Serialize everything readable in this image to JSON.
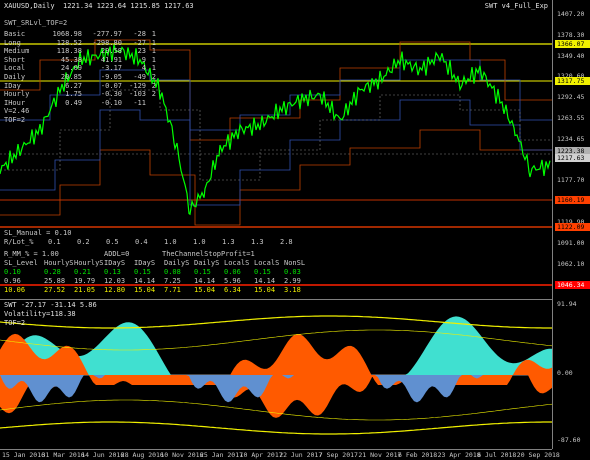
{
  "header": {
    "symbol_line": "XAUUSD,Daily  1221.34 1223.64 1215.85 1217.63",
    "indicator_name": "SWT_SRLvl_TOF=2",
    "right_label": "SWT v4_Full_Exp"
  },
  "srlvl_table": {
    "rows": [
      {
        "name": "Basic",
        "v1": "1068.98",
        "v2": "-277.97",
        "v3": "-28",
        "v4": "1"
      },
      {
        "name": "Long",
        "v1": "128.52",
        "v2": "-298.80",
        "v3": "-27",
        "v4": "1"
      },
      {
        "name": "Medium",
        "v1": "118.38",
        "v2": "29.58",
        "v3": "23",
        "v4": "1"
      },
      {
        "name": "Short",
        "v1": "45.38",
        "v2": "41.91",
        "v3": "9",
        "v4": "1"
      },
      {
        "name": "Local",
        "v1": "24.09",
        "v2": "-3.17",
        "v3": "4",
        "v4": "1"
      },
      {
        "name": "Daily",
        "v1": "20.85",
        "v2": "-9.05",
        "v3": "-49",
        "v4": "2"
      },
      {
        "name": "IDay",
        "v1": "6.27",
        "v2": "-0.07",
        "v3": "-129",
        "v4": "2"
      },
      {
        "name": "Hourly",
        "v1": "1.75",
        "v2": "-0.30",
        "v3": "-103",
        "v4": "2"
      },
      {
        "name": "IHour",
        "v1": "0.49",
        "v2": "-0.10",
        "v3": "-11",
        "v4": ""
      }
    ],
    "v_line": "V=2.46",
    "tof_line": "TOF=2"
  },
  "lot_table": {
    "sl_manual": "SL_Manual = 0.10",
    "lot_row_label": "R/Lot_%",
    "lot_row_values": [
      "0.1",
      "0.2",
      "0.5",
      "0.4",
      "1.0",
      "1.0",
      "1.3",
      "1.3",
      "2.8"
    ],
    "r_mm_line": "R_MM_% = 1.00",
    "addl_line": "ADDL=0",
    "channel_line": "TheChannelStopProfit=1",
    "headers": [
      "SL_Level",
      "HourlyS",
      "HourlyS",
      "IDayS",
      "IDayS",
      "DailyS",
      "DailyS",
      "LocalS",
      "LocalS",
      "NonSL"
    ],
    "rows": [
      [
        "0.10",
        "0.28",
        "0.21",
        "0.13",
        "0.15",
        "0.08",
        "0.15",
        "0.06",
        "0.15",
        "0.03"
      ],
      [
        "0.96",
        "25.88",
        "19.79",
        "12.03",
        "14.14",
        "7.25",
        "14.14",
        "5.96",
        "14.14",
        "2.99"
      ],
      [
        "10.06",
        "27.52",
        "21.05",
        "12.80",
        "15.04",
        "7.71",
        "15.04",
        "6.34",
        "15.04",
        "3.18"
      ]
    ]
  },
  "price_axis": {
    "labels": [
      "1407.20",
      "1378.30",
      "1349.40",
      "1320.60",
      "1292.45",
      "1263.55",
      "1234.65",
      "1205.75",
      "1177.70",
      "1148.80",
      "1119.90",
      "1091.00",
      "1062.10",
      "1034.05"
    ],
    "tags": [
      {
        "text": "1366.07",
        "color": "#f0f000",
        "text_color": "#000000"
      },
      {
        "text": "1317.75",
        "color": "#f0f000",
        "text_color": "#000000"
      },
      {
        "text": "1223.38",
        "color": "#b0b0b0",
        "text_color": "#000000"
      },
      {
        "text": "1217.63",
        "color": "#d0d0d0",
        "text_color": "#000000"
      },
      {
        "text": "1160.19",
        "color": "#ff4000",
        "text_color": "#000000"
      },
      {
        "text": "1122.09",
        "color": "#ff4000",
        "text_color": "#000000"
      },
      {
        "text": "1046.34",
        "color": "#ff0000",
        "text_color": "#ffffff"
      }
    ]
  },
  "sub_window": {
    "title_line": "SWT -27.17 -31.14 5.86",
    "volatility_line": "Volatility=118.38",
    "tof_line": "TOF=2",
    "axis_labels": [
      "91.94",
      "0.00",
      "-87.60"
    ]
  },
  "time_axis": {
    "labels": [
      "15 Jan 2016",
      "31 Mar 2016",
      "14 Jun 2016",
      "28 Aug 2016",
      "10 Nov 2016",
      "25 Jan 2017",
      "10 Apr 2017",
      "22 Jun 2017",
      "7 Sep 2017",
      "21 Nov 2017",
      "6 Feb 2018",
      "23 Apr 2018",
      "6 Jul 2018",
      "20 Sep 2018"
    ]
  },
  "colors": {
    "price_line": "#00ff00",
    "support": "#ff4000",
    "resistance_blue": "#4060c0",
    "level_yellow": "#f0f000",
    "fill_orange": "#ff5a00",
    "fill_cyan": "#40e0d0",
    "fill_blue": "#6090d0"
  }
}
